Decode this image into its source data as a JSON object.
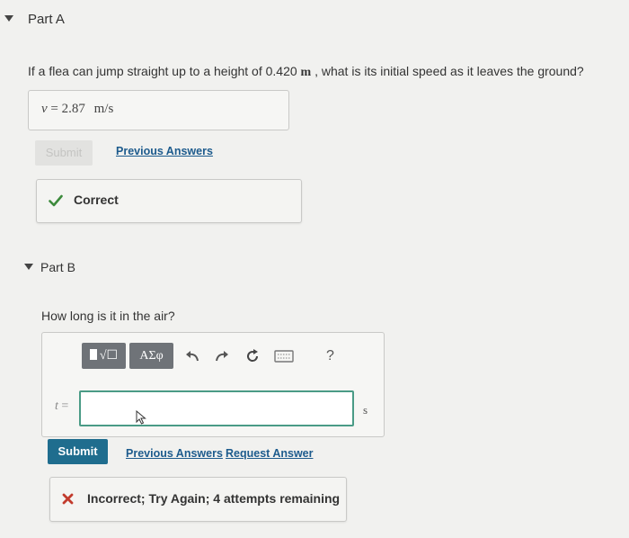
{
  "partA": {
    "title": "Part A",
    "question_pre": "If a flea can jump straight up to a height of 0.420 ",
    "question_unit": "m",
    "question_post": " , what is its initial speed as it leaves the ground?",
    "answer_var": "v",
    "answer_eq": " = ",
    "answer_value": "2.87",
    "answer_unit": "m/s",
    "submit_label": "Submit",
    "previous_answers_label": "Previous Answers",
    "feedback_label": "Correct"
  },
  "partB": {
    "title": "Part B",
    "question": "How long is it in the air?",
    "toolbar": {
      "templates_label": "√☐",
      "greek_label": "ΑΣφ",
      "help_label": "?"
    },
    "answer_var": "t",
    "answer_eq": " = ",
    "input_value": "",
    "unit": "s",
    "submit_label": "Submit",
    "previous_answers_label": "Previous Answers",
    "request_answer_label": "Request Answer",
    "feedback_label": "Incorrect; Try Again; 4 attempts remaining"
  },
  "colors": {
    "accent": "#1f6d8e",
    "correct": "#3c8a3c",
    "incorrect": "#c23b2d",
    "input_border": "#4a9b86"
  }
}
